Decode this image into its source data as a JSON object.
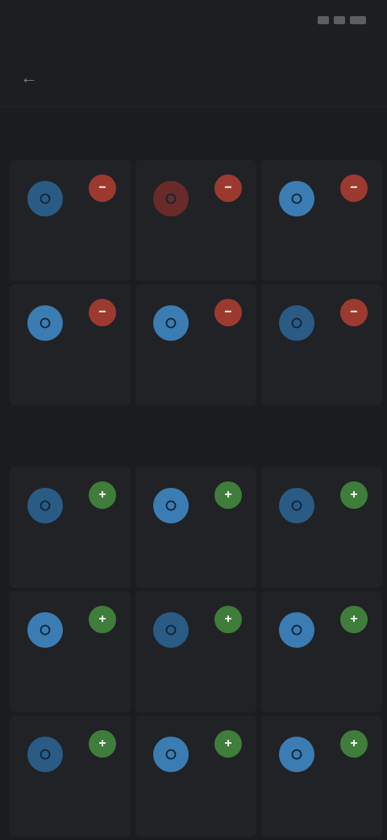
{
  "status_bar": {
    "time": "",
    "icons": [
      "signal-icon",
      "wifi-icon",
      "battery-icon"
    ]
  },
  "header": {
    "back_icon": "back-arrow-icon",
    "title": "",
    "action_label": ""
  },
  "sections": [
    {
      "title": "",
      "badge_color": "red",
      "badge_symbol": "−",
      "items": [
        {
          "label": "",
          "icon_style": "blue"
        },
        {
          "label": "",
          "icon_style": "red-dim"
        },
        {
          "label": "",
          "icon_style": "bright"
        },
        {
          "label": "",
          "icon_style": "bright"
        },
        {
          "label": "",
          "icon_style": "bright"
        },
        {
          "label": "",
          "icon_style": "blue"
        }
      ]
    },
    {
      "title": "",
      "badge_color": "green",
      "badge_symbol": "+",
      "items": [
        {
          "label": "",
          "icon_style": "blue"
        },
        {
          "label": "",
          "icon_style": "bright"
        },
        {
          "label": "",
          "icon_style": "blue"
        },
        {
          "label": "",
          "icon_style": "bright"
        },
        {
          "label": "",
          "icon_style": "blue"
        },
        {
          "label": "",
          "icon_style": "bright"
        },
        {
          "label": "",
          "icon_style": "blue"
        },
        {
          "label": "",
          "icon_style": "bright"
        },
        {
          "label": "",
          "icon_style": "bright"
        }
      ]
    }
  ],
  "colors": {
    "background": "#1b1c1e",
    "card": "#212225",
    "accent_blue": "#3b7db3",
    "remove_red": "#9c3a30",
    "add_green": "#3f7d3a"
  }
}
